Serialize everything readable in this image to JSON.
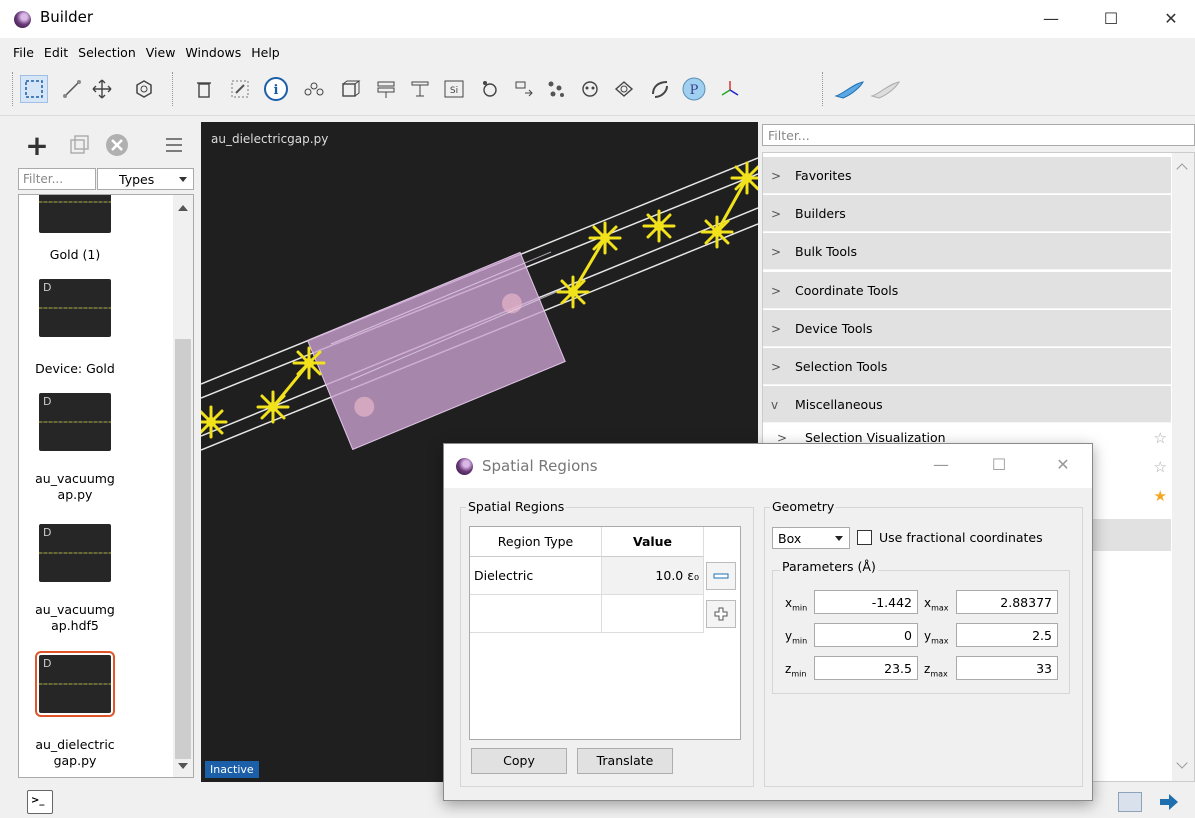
{
  "window": {
    "title": "Builder",
    "minimize": "—",
    "maximize": "☐",
    "close": "✕"
  },
  "menu": [
    "File",
    "Edit",
    "Selection",
    "View",
    "Windows",
    "Help"
  ],
  "left_panel": {
    "filter_placeholder": "Filter...",
    "types_label": "Types",
    "items": [
      {
        "label": "Gold (1)",
        "badge": ""
      },
      {
        "label": "Device: Gold",
        "badge": "D"
      },
      {
        "label": "au_vacuumg\nap.py",
        "badge": "D"
      },
      {
        "label": "au_vacuumg\nap.hdf5",
        "badge": "D"
      },
      {
        "label": "au_dielectric\ngap.py",
        "badge": "D"
      }
    ]
  },
  "viewport": {
    "title": "au_dielectricgap.py",
    "status": "Inactive"
  },
  "right_panel": {
    "filter_placeholder": "Filter...",
    "categories": [
      {
        "label": "Favorites",
        "chevron": ">"
      },
      {
        "label": "Builders",
        "chevron": ">"
      },
      {
        "label": "Bulk Tools",
        "chevron": ">"
      },
      {
        "label": "Coordinate Tools",
        "chevron": ">"
      },
      {
        "label": "Device Tools",
        "chevron": ">"
      },
      {
        "label": "Selection Tools",
        "chevron": ">"
      },
      {
        "label": "Miscellaneous",
        "chevron": "v"
      }
    ],
    "sub_items": [
      {
        "label": "Selection Visualization",
        "chevron": ">"
      }
    ]
  },
  "dialog": {
    "title": "Spatial Regions",
    "minimize": "—",
    "maximize": "☐",
    "close": "✕",
    "regions_group": "Spatial Regions",
    "table": {
      "headers": [
        "Region Type",
        "Value"
      ],
      "rows": [
        {
          "type": "Dielectric",
          "value": "10.0 ε₀"
        }
      ]
    },
    "copy_button": "Copy",
    "translate_button": "Translate",
    "geometry_group": "Geometry",
    "shape": "Box",
    "fractional_label": "Use fractional coordinates",
    "parameters_group": "Parameters (Å)",
    "params": {
      "xmin": "-1.442",
      "xmax": "2.88377",
      "ymin": "0",
      "ymax": "2.5",
      "zmin": "23.5",
      "zmax": "33"
    },
    "param_labels": {
      "x": "x",
      "y": "y",
      "z": "z",
      "min": "min",
      "max": "max"
    }
  },
  "colors": {
    "atom": "#f2e21b",
    "region": "#c9a0d0",
    "selected_outline": "#e0552a",
    "inactive_badge": "#1a5fa8"
  }
}
